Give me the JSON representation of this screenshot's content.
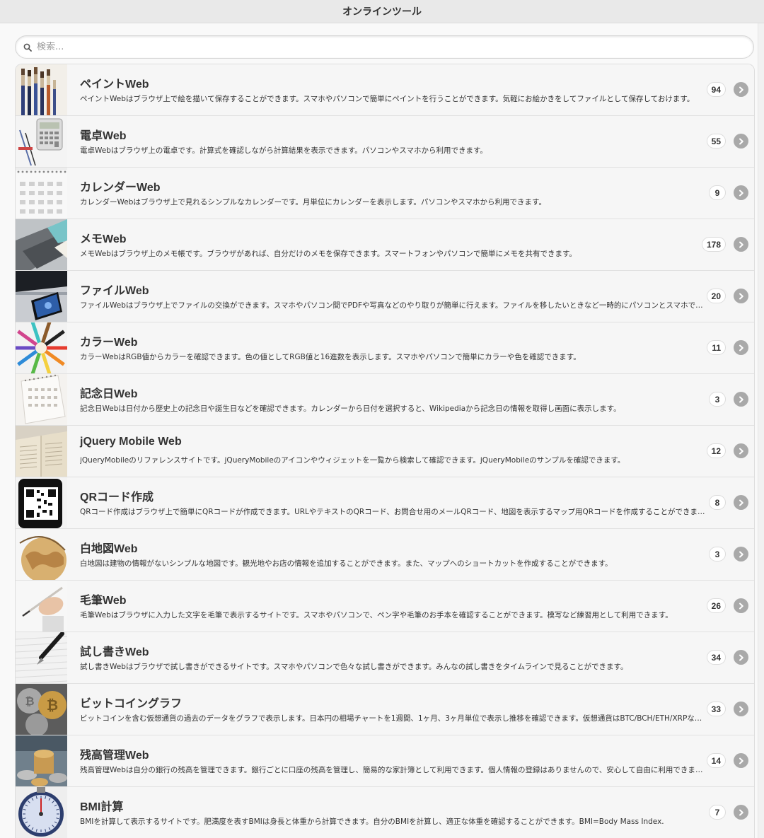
{
  "header": {
    "title": "オンラインツール"
  },
  "search": {
    "placeholder": "検索..."
  },
  "items": [
    {
      "title": "ペイントWeb",
      "desc": "ペイントWebはブラウザ上で絵を描いて保存することができます。スマホやパソコンで簡単にペイントを行うことができます。気軽にお絵かきをしてファイルとして保存しておけます。",
      "count": "94",
      "thumb": "brushes-icon"
    },
    {
      "title": "電卓Web",
      "desc": "電卓Webはブラウザ上の電卓です。計算式を確認しながら計算結果を表示できます。パソコンやスマホから利用できます。",
      "count": "55",
      "thumb": "calculator-icon"
    },
    {
      "title": "カレンダーWeb",
      "desc": "カレンダーWebはブラウザ上で見れるシンプルなカレンダーです。月単位にカレンダーを表示します。パソコンやスマホから利用できます。",
      "count": "9",
      "thumb": "calendar-icon"
    },
    {
      "title": "メモWeb",
      "desc": "メモWebはブラウザ上のメモ帳です。ブラウザがあれば、自分だけのメモを保存できます。スマートフォンやパソコンで簡単にメモを共有できます。",
      "count": "178",
      "thumb": "notebook-icon"
    },
    {
      "title": "ファイルWeb",
      "desc": "ファイルWebはブラウザ上でファイルの交換ができます。スマホやパソコン間でPDFや写真などのやり取りが簡単に行えます。ファイルを移したいときなど一時的にパソコンとスマホで利用できます。",
      "count": "20",
      "thumb": "laptop-phone-icon"
    },
    {
      "title": "カラーWeb",
      "desc": "カラーWebはRGB値からカラーを確認できます。色の値としてRGB値と16進数を表示します。スマホやパソコンで簡単にカラーや色を確認できます。",
      "count": "11",
      "thumb": "color-pencils-icon"
    },
    {
      "title": "記念日Web",
      "desc": "記念日Webは日付から歴史上の記念日や誕生日などを確認できます。カレンダーから日付を選択すると、Wikipediaから記念日の情報を取得し画面に表示します。",
      "count": "3",
      "thumb": "desk-calendar-icon"
    },
    {
      "title": "jQuery Mobile Web",
      "desc": "jQueryMobileのリファレンスサイトです。jQueryMobileのアイコンやウィジェットを一覧から検索して確認できます。jQueryMobileのサンプルを確認できます。",
      "count": "12",
      "thumb": "open-book-icon"
    },
    {
      "title": "QRコード作成",
      "desc": "QRコード作成はブラウザ上で簡単にQRコードが作成できます。URLやテキストのQRコード、お問合せ用のメールQRコード、地図を表示するマップ用QRコードを作成することができます。",
      "count": "8",
      "thumb": "qr-phone-icon"
    },
    {
      "title": "白地図Web",
      "desc": "白地図は建物の情報がないシンプルな地図です。観光地やお店の情報を追加することができます。また、マップへのショートカットを作成することができます。",
      "count": "3",
      "thumb": "globe-icon"
    },
    {
      "title": "毛筆Web",
      "desc": "毛筆Webはブラウザに入力した文字を毛筆で表示するサイトです。スマホやパソコンで、ペン字や毛筆のお手本を確認することができます。模写など練習用として利用できます。",
      "count": "26",
      "thumb": "writing-pen-icon"
    },
    {
      "title": "試し書きWeb",
      "desc": "試し書きWebはブラウザで試し書きができるサイトです。スマホやパソコンで色々な試し書きができます。みんなの試し書きをタイムラインで見ることができます。",
      "count": "34",
      "thumb": "fountain-pen-icon"
    },
    {
      "title": "ビットコイングラフ",
      "desc": "ビットコインを含む仮想通貨の過去のデータをグラフで表示します。日本円の相場チャートを1週間、1ヶ月、3ヶ月単位で表示し推移を確認できます。仮想通貨はBTC/BCH/ETH/XRPなどに対応しています。",
      "count": "33",
      "thumb": "bitcoin-icon"
    },
    {
      "title": "残高管理Web",
      "desc": "残高管理Webは自分の銀行の残高を管理できます。銀行ごとに口座の残高を管理し、簡易的な家計簿として利用できます。個人情報の登録はありませんので、安心して自由に利用できます。",
      "count": "14",
      "thumb": "coins-icon"
    },
    {
      "title": "BMI計算",
      "desc": "BMIを計算して表示するサイトです。肥満度を表すBMIは身長と体重から計算できます。自分のBMIを計算し、適正な体重を確認することができます。BMI=Body Mass Index.",
      "count": "7",
      "thumb": "scale-icon"
    }
  ]
}
